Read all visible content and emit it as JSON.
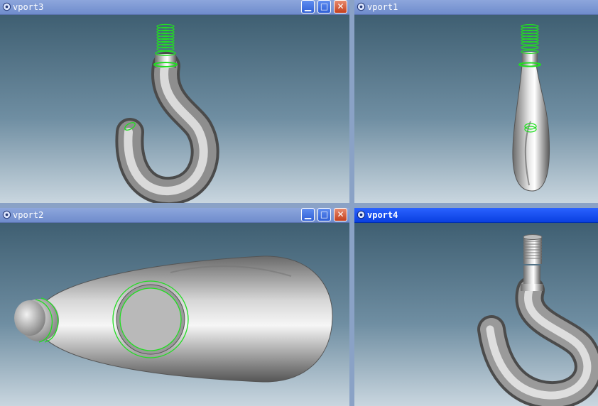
{
  "viewports": {
    "vport3": {
      "title": "vport3",
      "active": false
    },
    "vport1": {
      "title": "vport1",
      "active": false
    },
    "vport2": {
      "title": "vport2",
      "active": false
    },
    "vport4": {
      "title": "vport4",
      "active": true
    }
  },
  "buttons": {
    "minimize": "▁",
    "maximize": "□",
    "close": "✕"
  },
  "colors": {
    "viewport_top": "#3f5f72",
    "viewport_bottom": "#c6d4de",
    "title_inactive": "#7a96d6",
    "title_active": "#1a52f5",
    "highlight_green": "#22dd22"
  },
  "icons": {
    "viewport_icon": "gear-icon"
  }
}
